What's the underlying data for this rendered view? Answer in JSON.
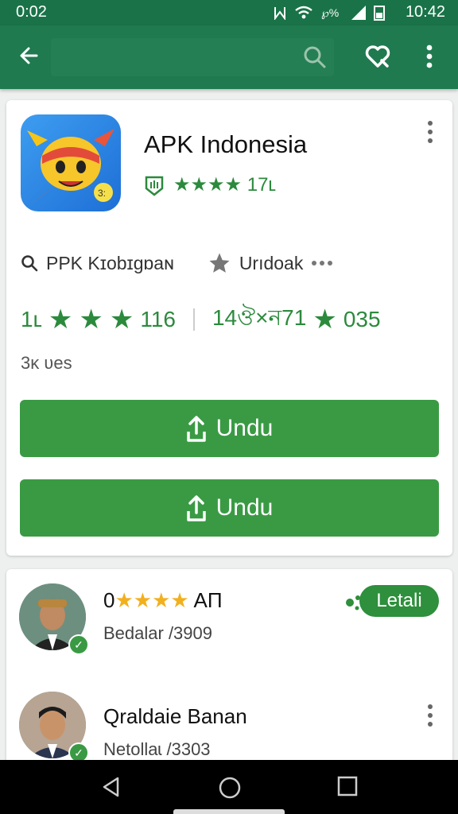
{
  "status_bar": {
    "time_left": "0:02",
    "time_right": "10:42"
  },
  "toolbar": {
    "search_placeholder": ""
  },
  "app": {
    "title": "APK Indonesia",
    "rating_text": "★★★★ 17ʟ",
    "developer": "PPK Kɪobɪgɒaɴ",
    "download_label": "Urıdoak",
    "stat_left": "1ʟ",
    "stat_left_count": "116",
    "stat_right": "14ঔ×ন71",
    "stat_right_count": "035",
    "meta": "3ᴋ ʋes",
    "button1_label": "Undu",
    "button2_label": "Undu"
  },
  "reviews": [
    {
      "prefix": "0",
      "stars": "★★★★",
      "name": "AП",
      "sub": "Bedalar /3909",
      "detail_label": "Letali"
    },
    {
      "name": "Qraldaie Banan",
      "sub": "Netollaɩ /3303"
    }
  ],
  "colors": {
    "toolbar": "#1f7a4f",
    "accent": "#3a9a44",
    "star_green": "#2c8a3d",
    "star_yellow": "#f2b01e"
  }
}
